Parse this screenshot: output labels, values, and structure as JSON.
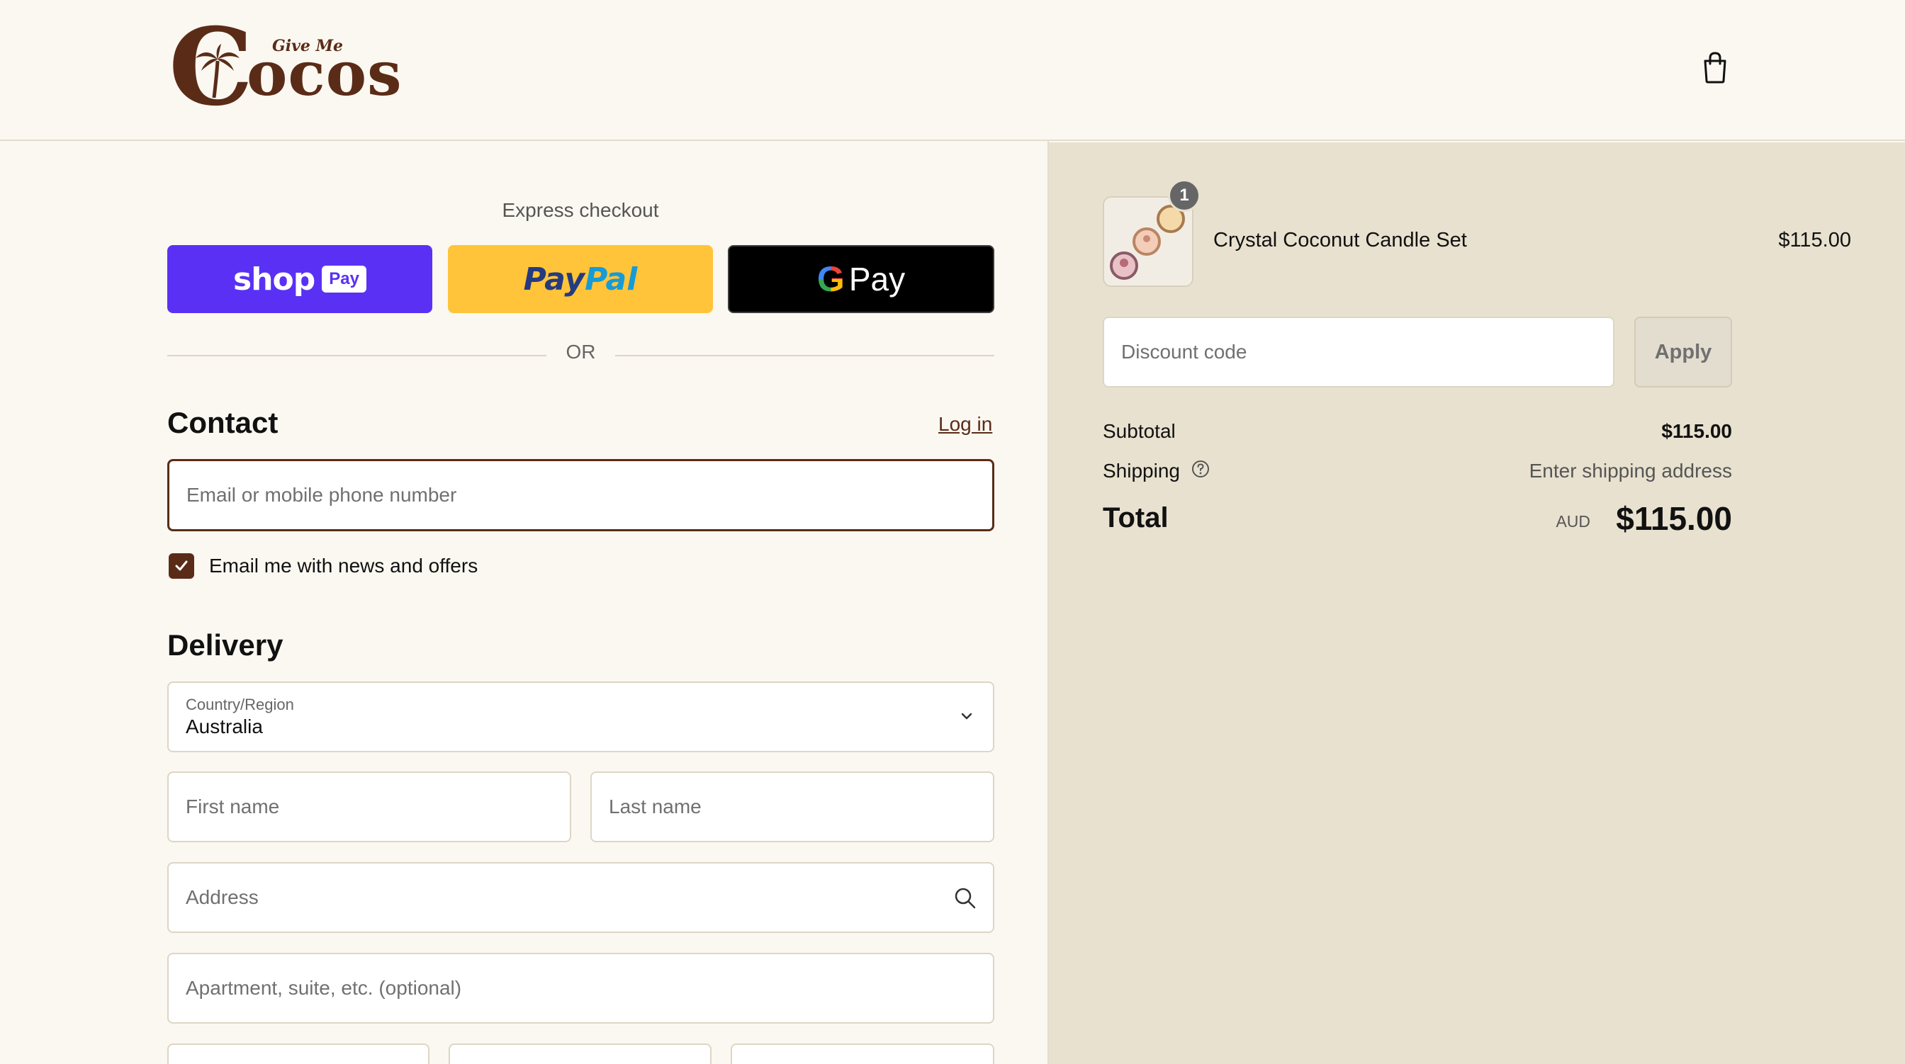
{
  "header": {
    "logo_main": "ocos",
    "logo_initial": "C",
    "logo_tagline": "Give Me"
  },
  "express": {
    "label": "Express checkout",
    "shop_pay": {
      "wordmark": "shop",
      "badge": "Pay"
    },
    "paypal": {
      "part1": "Pay",
      "part2": "Pal"
    },
    "gpay": {
      "g": "G",
      "text": "Pay"
    },
    "or": "OR"
  },
  "contact": {
    "title": "Contact",
    "login": "Log in",
    "email_placeholder": "Email or mobile phone number",
    "newsletter_label": "Email me with news and offers",
    "newsletter_checked": true
  },
  "delivery": {
    "title": "Delivery",
    "country_label": "Country/Region",
    "country_value": "Australia",
    "first_name_placeholder": "First name",
    "last_name_placeholder": "Last name",
    "address_placeholder": "Address",
    "apartment_placeholder": "Apartment, suite, etc. (optional)"
  },
  "summary": {
    "item": {
      "name": "Crystal Coconut Candle Set",
      "price": "$115.00",
      "quantity": "1"
    },
    "discount_placeholder": "Discount code",
    "apply": "Apply",
    "subtotal_label": "Subtotal",
    "subtotal_value": "$115.00",
    "shipping_label": "Shipping",
    "shipping_value": "Enter shipping address",
    "total_label": "Total",
    "currency": "AUD",
    "total_value": "$115.00"
  },
  "colors": {
    "brand": "#5a2c18",
    "page_bg": "#fbf8f1",
    "summary_bg": "#e8e1cf",
    "shop_pay": "#5a31f4",
    "paypal": "#ffc439"
  }
}
